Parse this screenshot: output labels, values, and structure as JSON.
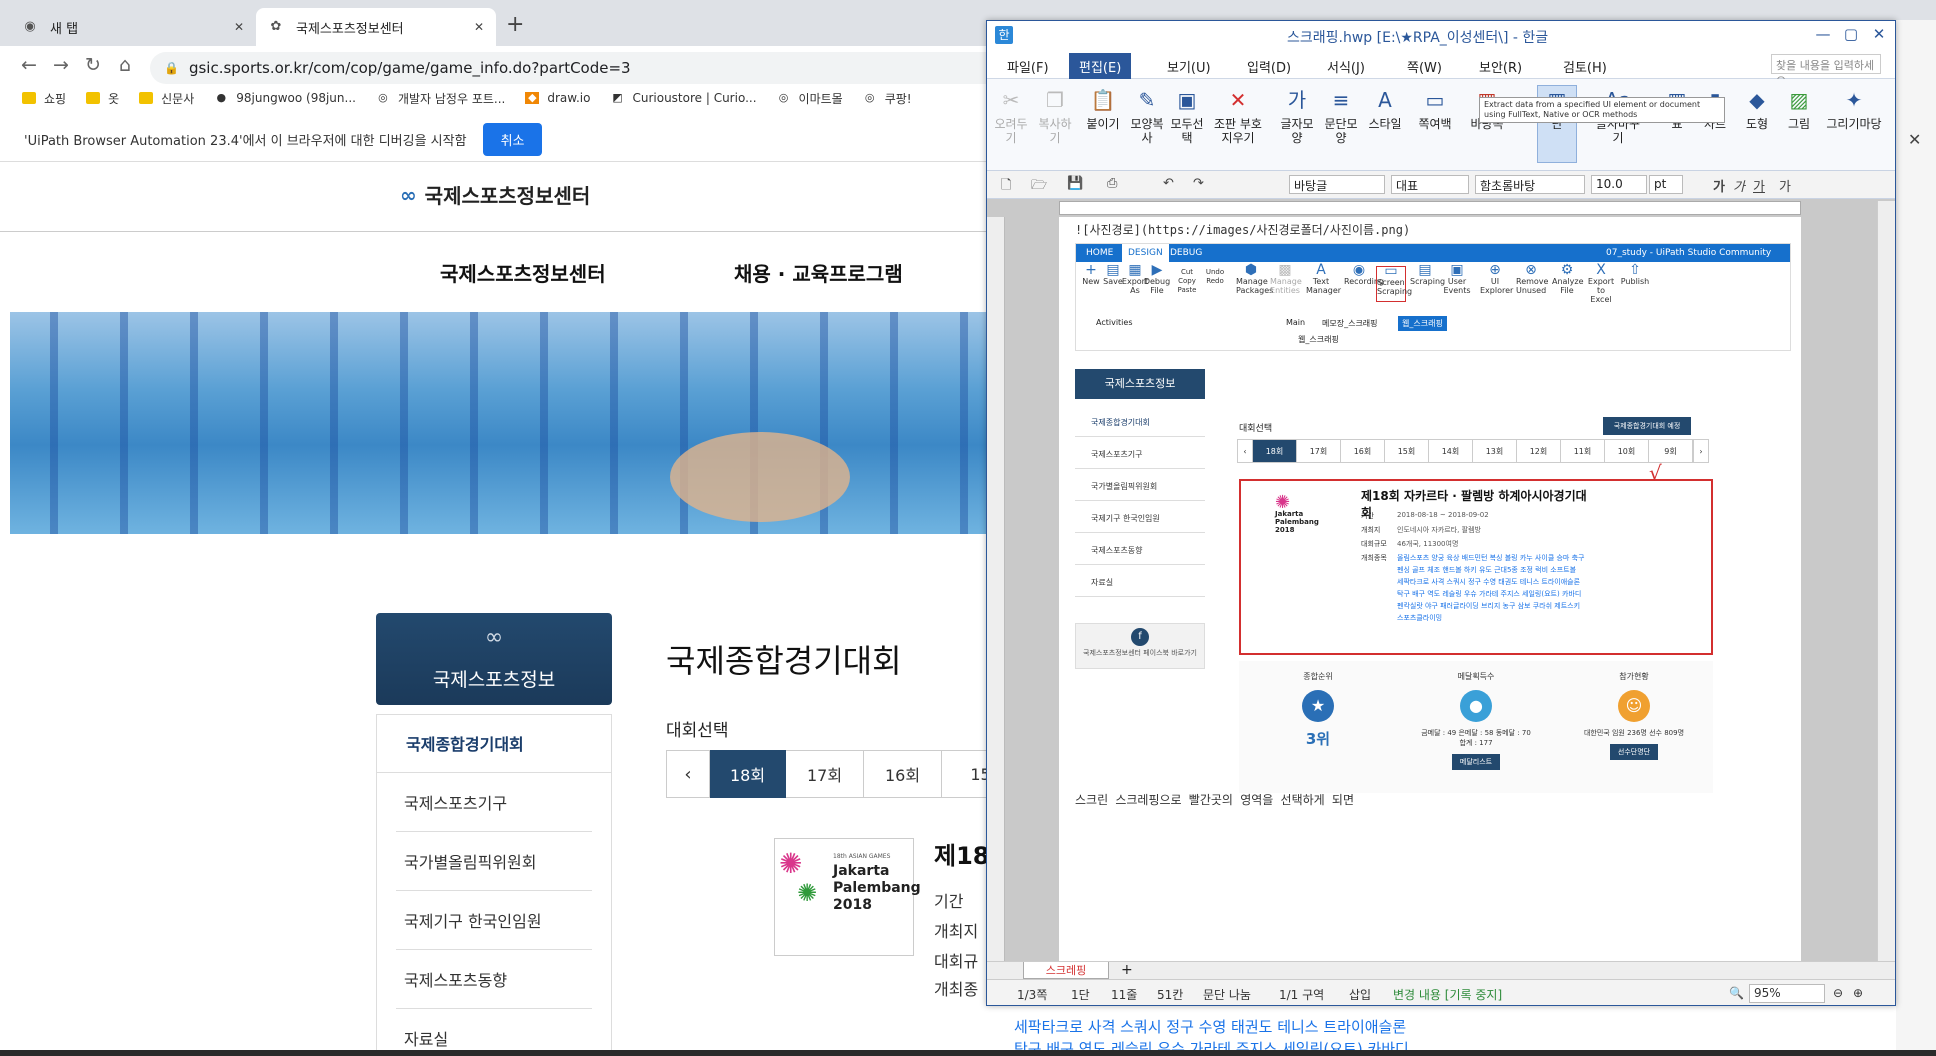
{
  "browser": {
    "tabs": [
      {
        "label": "새 탭"
      },
      {
        "label": "국제스포츠정보센터"
      }
    ],
    "url": "gsic.sports.or.kr/com/cop/game/game_info.do?partCode=3",
    "bookmarks": [
      "쇼핑",
      "옷",
      "신문사",
      "98jungwoo (98jun...",
      "개발자 남정우 포트...",
      "draw.io",
      "Curioustore | Curio...",
      "이마트몰",
      "쿠팡!"
    ],
    "infobar": {
      "message": "'UiPath Browser Automation 23.4'에서 이 브라우저에 대한 디버깅을 시작함",
      "cancel_label": "취소"
    }
  },
  "site": {
    "logo_text": "국제스포츠정보센터",
    "nav": [
      "국제스포츠정보센터",
      "채용 · 교육프로그램"
    ],
    "sidebar_title": "국제스포츠정보",
    "sidebar_items": [
      "국제종합경기대회",
      "국제스포츠기구",
      "국가별올림픽위원회",
      "국제기구 한국인임원",
      "국제스포츠동향",
      "자료실"
    ],
    "content_title": "국제종합경기대회",
    "select_label": "대회선택",
    "rounds": [
      "18회",
      "17회",
      "16회",
      "15"
    ],
    "prev_glyph": "‹",
    "poster": {
      "event": "18th ASIAN GAMES",
      "line1": "Jakarta",
      "line2": "Palembang",
      "line3": "2018"
    },
    "subhead": "제18",
    "info_labels": [
      "기간",
      "개최지",
      "대회규",
      "개최종"
    ],
    "overflow_lines": [
      "세팍타크로 사격 스쿼시 정구 수영 태권도 테니스 트라이애슬론",
      "탁구 배구 역도 레슬링 우슈 가라테 주지스 세일링(요트) 카바디"
    ]
  },
  "hwp": {
    "title": "스크래핑.hwp [E:\\★RPA_이성센터\\] - 한글",
    "menu": [
      "파일(F)",
      "편집(E)",
      "보기(U)",
      "입력(D)",
      "서식(J)",
      "쪽(W)",
      "보안(R)",
      "검토(H)"
    ],
    "search_placeholder": "찾을 내용을 입력하세요.",
    "ribbon": [
      {
        "label": "오려두기",
        "icon": "scissors-icon",
        "glyph": "✂"
      },
      {
        "label": "복사하기",
        "icon": "copy-icon",
        "glyph": "❐"
      },
      {
        "label": "붙이기",
        "icon": "paste-icon",
        "glyph": "📋"
      },
      {
        "label": "모양복사",
        "icon": "format-painter-icon",
        "glyph": "✎"
      },
      {
        "label": "모두선택",
        "icon": "select-all-icon",
        "glyph": "▣"
      },
      {
        "label": "조판 부호 지우기",
        "icon": "clear-format-icon",
        "glyph": "✕"
      },
      {
        "label": "글자모양",
        "icon": "char-shape-icon",
        "glyph": "가"
      },
      {
        "label": "문단모양",
        "icon": "para-shape-icon",
        "glyph": "≡"
      },
      {
        "label": "스타일",
        "icon": "style-icon",
        "glyph": "A"
      },
      {
        "label": "쪽여백",
        "icon": "page-margin-icon",
        "glyph": "▭"
      },
      {
        "label": "바탕쪽",
        "icon": "master-page-icon",
        "glyph": "▦"
      },
      {
        "label": "단",
        "icon": "columns-icon",
        "glyph": "▥"
      },
      {
        "label": "글자바꾸기",
        "icon": "replace-char-icon",
        "glyph": "Aa"
      },
      {
        "label": "표",
        "icon": "table-icon",
        "glyph": "▦"
      },
      {
        "label": "차트",
        "icon": "chart-icon",
        "glyph": "▮"
      },
      {
        "label": "도형",
        "icon": "shape-icon",
        "glyph": "◆"
      },
      {
        "label": "그림",
        "icon": "picture-icon",
        "glyph": "▨"
      },
      {
        "label": "그리기마당",
        "icon": "drawing-icon",
        "glyph": "✦"
      }
    ],
    "format": {
      "style": "바탕글",
      "lang": "대표",
      "font": "함초롬바탕",
      "size": "10.0",
      "unit": "pt",
      "styles": [
        "가",
        "가",
        "가",
        "가"
      ]
    },
    "doc": {
      "image_path_line": "![사진경로](https://images/사진경로폴더/사진이름.png)",
      "caption": "스크린 스크레핑으로 빨간곳의 영역을 선택하게 되면"
    },
    "uipath": {
      "tabs": [
        "HOME",
        "DESIGN",
        "DEBUG"
      ],
      "window_title": "07_study - UiPath Studio Community",
      "buttons": [
        "New",
        "Save",
        "Export As",
        "Debug File",
        "Manage Packages",
        "Manage Entities",
        "Text Manager",
        "Recording",
        "Screen Scraping",
        "Scraping",
        "User Events",
        "UI Explorer",
        "Remove Unused",
        "Analyze File",
        "Export to Excel",
        "Publish"
      ],
      "clip": [
        "Cut",
        "Copy",
        "Paste",
        "Undo",
        "Redo"
      ],
      "panel": "Activities",
      "doc_tabs": [
        "Main",
        "메모장_스크래핑",
        "웹_스크래핑"
      ],
      "tooltip": "Extract data from a specified UI element or document using FullText, Native or OCR methods"
    },
    "web": {
      "sidebar_title": "국제스포츠정보",
      "sidebar_items": [
        "국제종합경기대회",
        "국제스포츠기구",
        "국가별올림픽위원회",
        "국제기구 한국인임원",
        "국제스포츠동향",
        "자료실"
      ],
      "facebook_text": "국제스포츠정보센터 페이스북 바로가기",
      "select_label": "대회선택",
      "schedule_btn": "국제종합경기대회 예정",
      "rounds": [
        "18회",
        "17회",
        "16회",
        "15회",
        "14회",
        "13회",
        "12회",
        "11회",
        "10회",
        "9회"
      ],
      "event_title": "제18회 자카르타 · 팔렘방 하계아시아경기대회",
      "rows": [
        {
          "k": "기간",
          "v": "2018-08-18 ~ 2018-09-02"
        },
        {
          "k": "개최지",
          "v": "인도네시아 자카르타, 팔렘방"
        },
        {
          "k": "대회규모",
          "v": "46개국, 11300여명"
        },
        {
          "k": "개최종목",
          "v": ""
        }
      ],
      "sports_lines": [
        "올림스포츠 양궁 육상 배드민턴 복싱 볼링 카누 사이클 승마 축구",
        "펜싱 골프 체조 핸드볼 하키 유도 근대5종 조정 럭비 소프트볼",
        "세팍타크로 사격 스쿼시 정구 수영 태권도 테니스 트라이애슬론",
        "탁구 배구 역도 레슬링 우슈 가라테 주지스 세일링(요트) 카바디",
        "펜칵실랏 야구 패러글라이딩 브리지 농구 삼보 쿠라쉬 제트스키",
        "스포츠클라이밍"
      ],
      "stats": [
        {
          "title": "종합순위",
          "value": "3위",
          "button": ""
        },
        {
          "title": "메달획득수",
          "value": "금메달 : 49  은메달 : 58  동메달 : 70  합계 : 177",
          "button": "메달리스트"
        },
        {
          "title": "참가현황",
          "value": "대한민국 임원 236명  선수 809명",
          "button": "선수단명단"
        }
      ],
      "check_glyph": "√"
    },
    "sheet_tab": "스크레핑",
    "status": [
      "1/3쪽",
      "1단",
      "11줄",
      "51칸",
      "문단 나눔",
      "1/1 구역",
      "삽입",
      "변경 내용 [기록 중지]"
    ],
    "zoom": "95%"
  }
}
